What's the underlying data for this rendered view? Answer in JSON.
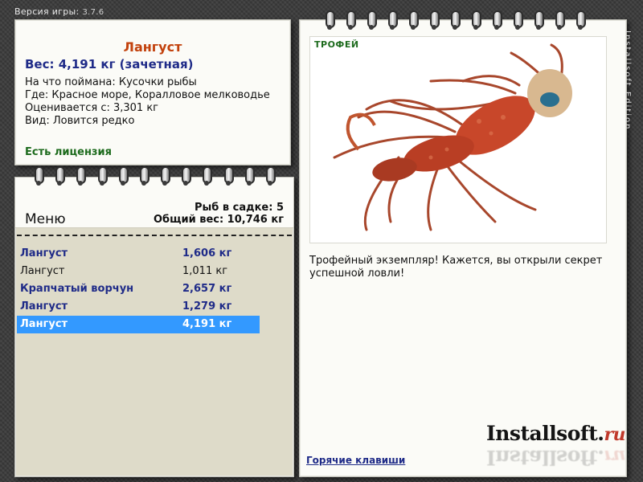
{
  "version": {
    "label": "Версия игры:",
    "number": "3.7.6"
  },
  "fish": {
    "name": "Лангуст",
    "weight": "Вес: 4,191 кг (зачетная)",
    "details": [
      "На что поймана: Кусочки рыбы",
      "Где: Красное море, Коралловое мелководье",
      "Оценивается с: 3,301 кг",
      "Вид: Ловится редко"
    ],
    "license": "Есть лицензия"
  },
  "menu": {
    "title": "Меню",
    "count_label": "Рыб в садке: 5",
    "total_label": "Общий вес: 10,746 кг",
    "items": [
      {
        "name": "Лангуст",
        "weight": "1,606 кг",
        "bold": true,
        "selected": false
      },
      {
        "name": "Лангуст",
        "weight": "1,011 кг",
        "bold": false,
        "selected": false
      },
      {
        "name": "Крапчатый ворчун",
        "weight": "2,657 кг",
        "bold": true,
        "selected": false
      },
      {
        "name": "Лангуст",
        "weight": "1,279 кг",
        "bold": true,
        "selected": false
      },
      {
        "name": "Лангуст",
        "weight": "4,191 кг",
        "bold": true,
        "selected": true
      }
    ]
  },
  "trophy": {
    "label": "ТРОФЕЙ",
    "caption": "Трофейный экземпляр! Кажется, вы открыли секрет успешной ловли!",
    "hotkeys": "Горячие клавиши"
  },
  "logo": {
    "main": "Installsoft.",
    "suffix": "ru"
  },
  "side_text": "Installsoft Edition",
  "colors": {
    "accent": "#c2410c",
    "link": "#1f2b88",
    "green": "#1d6b1d",
    "selection": "#3399ff"
  }
}
